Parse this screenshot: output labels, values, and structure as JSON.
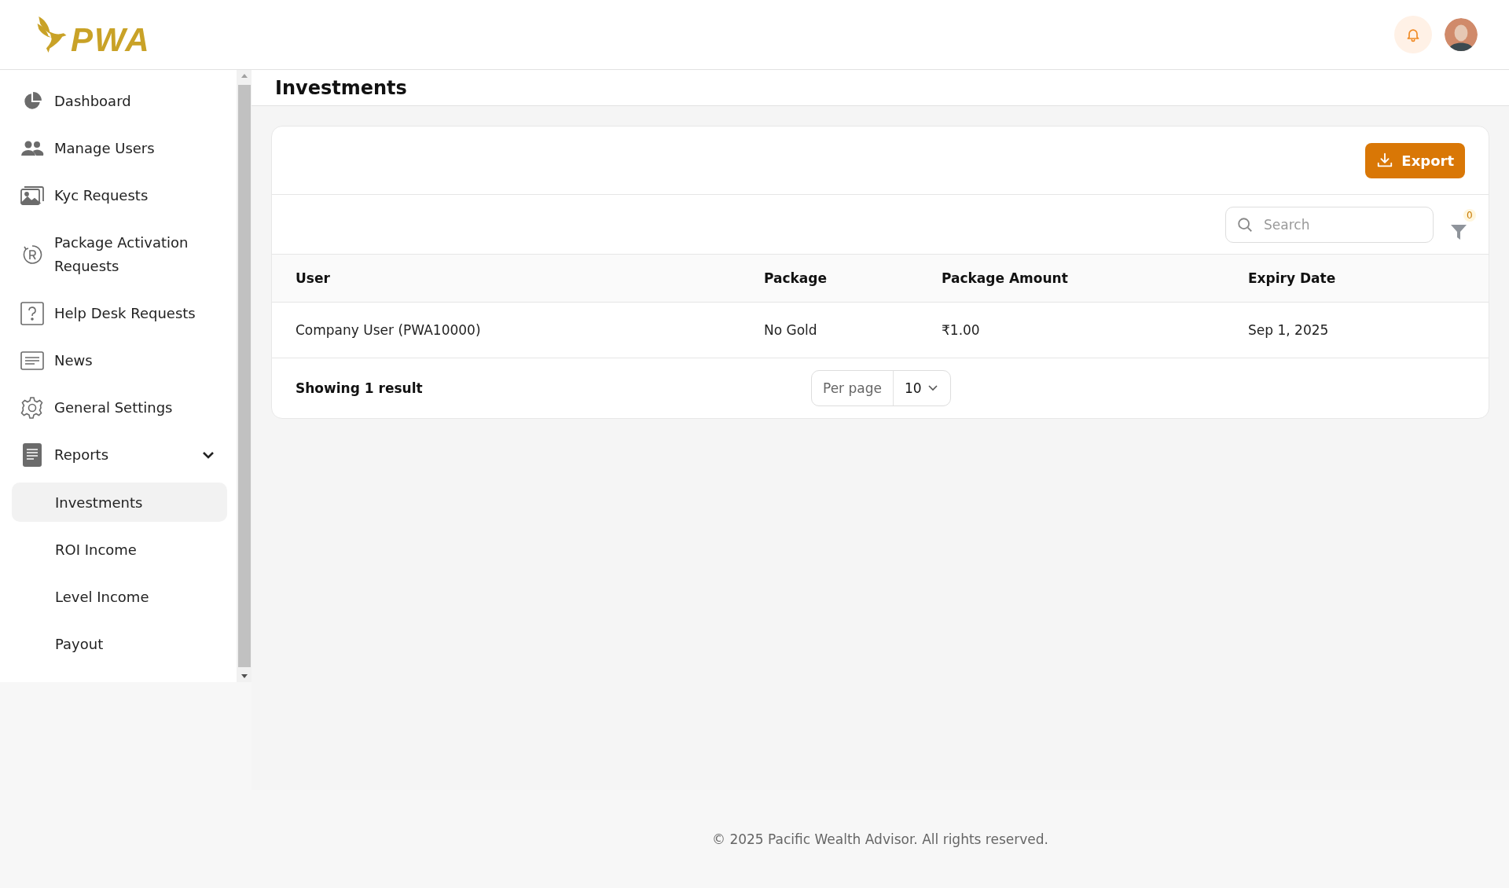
{
  "header": {
    "logo": "PWA"
  },
  "sidebar": {
    "items": [
      {
        "label": "Dashboard",
        "selected": false
      },
      {
        "label": "Manage Users",
        "selected": false
      },
      {
        "label": "Kyc Requests",
        "selected": false
      },
      {
        "label": "Package Activation Requests",
        "selected": false
      },
      {
        "label": "Help Desk Requests",
        "selected": false
      },
      {
        "label": "News",
        "selected": false
      },
      {
        "label": "General Settings",
        "selected": false
      },
      {
        "label": "Reports",
        "selected": false,
        "expanded": true,
        "children": [
          {
            "label": "Investments",
            "selected": true
          },
          {
            "label": "ROI Income",
            "selected": false
          },
          {
            "label": "Level Income",
            "selected": false
          },
          {
            "label": "Payout",
            "selected": false
          }
        ]
      }
    ]
  },
  "page": {
    "title": "Investments"
  },
  "toolbar": {
    "export_button": "Export",
    "search": {
      "placeholder": "Search"
    },
    "filter_count": "0"
  },
  "table": {
    "columns": [
      "User",
      "Package",
      "Package Amount",
      "Expiry Date"
    ],
    "rows": [
      [
        "Company User (PWA10000)",
        "No Gold",
        "₹1.00",
        "Sep 1, 2025"
      ]
    ]
  },
  "pagination": {
    "summary": "Showing 1 result",
    "per_page_label": "Per page",
    "per_page_value": "10"
  },
  "footer": {
    "copyright": "© 2025 Pacific Wealth Advisor. All rights reserved."
  }
}
